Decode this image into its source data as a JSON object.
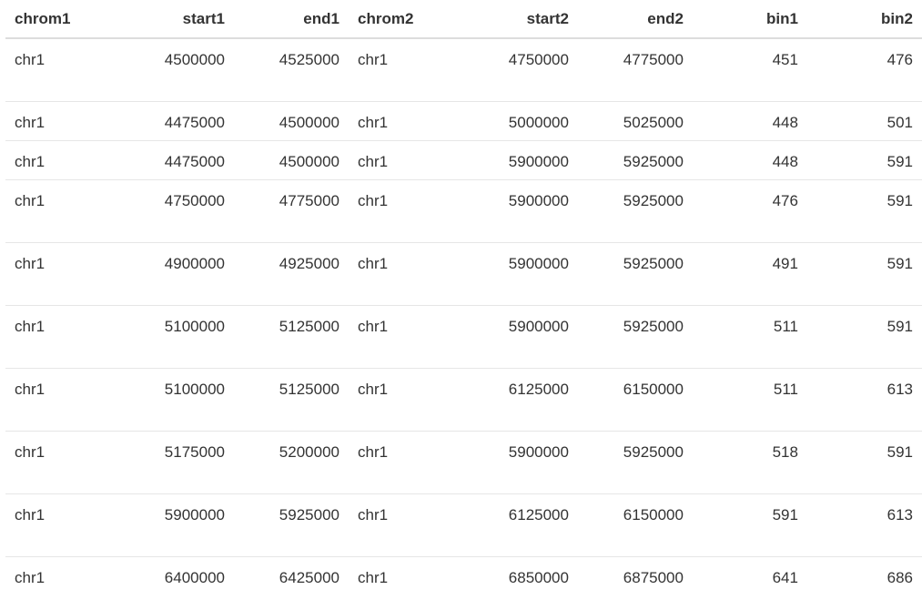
{
  "table": {
    "columns": [
      {
        "label": "chrom1",
        "align": "left"
      },
      {
        "label": "start1",
        "align": "right"
      },
      {
        "label": "end1",
        "align": "right"
      },
      {
        "label": "chrom2",
        "align": "left"
      },
      {
        "label": "start2",
        "align": "right"
      },
      {
        "label": "end2",
        "align": "right"
      },
      {
        "label": "bin1",
        "align": "right"
      },
      {
        "label": "bin2",
        "align": "right"
      }
    ],
    "rows": [
      [
        "chr1",
        "4500000",
        "4525000",
        "chr1",
        "4750000",
        "4775000",
        "451",
        "476"
      ],
      [
        "chr1",
        "4475000",
        "4500000",
        "chr1",
        "5000000",
        "5025000",
        "448",
        "501"
      ],
      [
        "chr1",
        "4475000",
        "4500000",
        "chr1",
        "5900000",
        "5925000",
        "448",
        "591"
      ],
      [
        "chr1",
        "4750000",
        "4775000",
        "chr1",
        "5900000",
        "5925000",
        "476",
        "591"
      ],
      [
        "chr1",
        "4900000",
        "4925000",
        "chr1",
        "5900000",
        "5925000",
        "491",
        "591"
      ],
      [
        "chr1",
        "5100000",
        "5125000",
        "chr1",
        "5900000",
        "5925000",
        "511",
        "591"
      ],
      [
        "chr1",
        "5100000",
        "5125000",
        "chr1",
        "6125000",
        "6150000",
        "511",
        "613"
      ],
      [
        "chr1",
        "5175000",
        "5200000",
        "chr1",
        "5900000",
        "5925000",
        "518",
        "591"
      ],
      [
        "chr1",
        "5900000",
        "5925000",
        "chr1",
        "6125000",
        "6150000",
        "591",
        "613"
      ],
      [
        "chr1",
        "6400000",
        "6425000",
        "chr1",
        "6850000",
        "6875000",
        "641",
        "686"
      ]
    ]
  }
}
